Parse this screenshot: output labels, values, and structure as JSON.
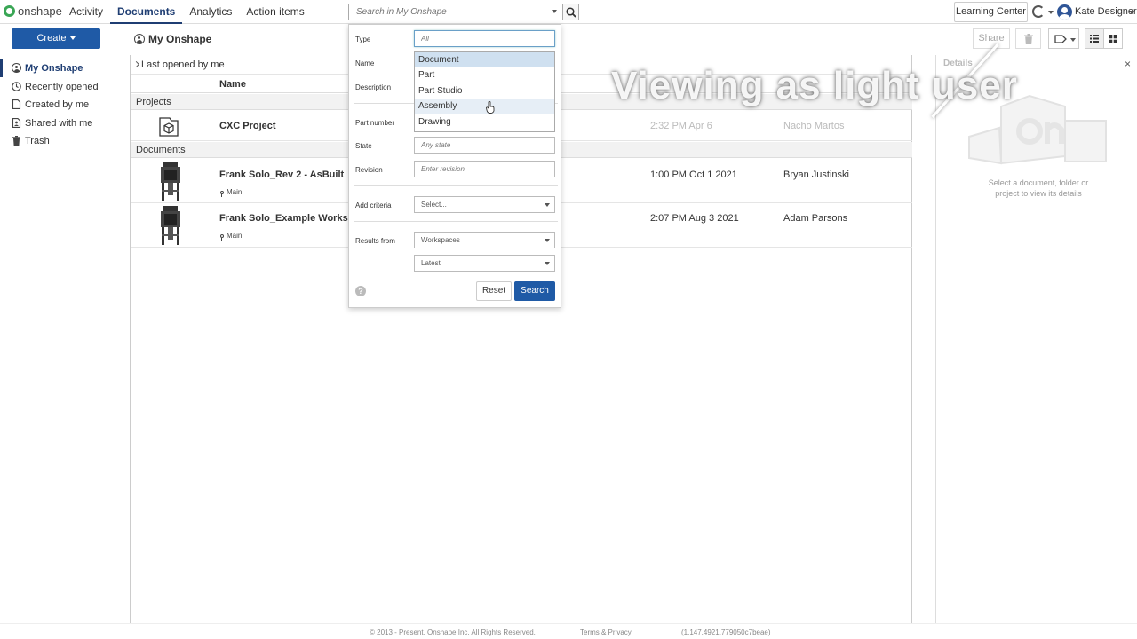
{
  "app": {
    "logo_text": "onshape"
  },
  "nav": [
    {
      "label": "Activity"
    },
    {
      "label": "Documents"
    },
    {
      "label": "Analytics"
    },
    {
      "label": "Action items"
    }
  ],
  "search": {
    "placeholder": "Search in My Onshape"
  },
  "header": {
    "learning_center": "Learning Center",
    "user_name": "Kate Designer"
  },
  "toolbar": {
    "create_label": "Create",
    "share_label": "Share"
  },
  "page_title": "My Onshape",
  "sidebar": {
    "items": [
      {
        "label": "My Onshape"
      },
      {
        "label": "Recently opened"
      },
      {
        "label": "Created by me"
      },
      {
        "label": "Shared with me"
      },
      {
        "label": "Trash"
      }
    ]
  },
  "list": {
    "filter_label": "Last opened by me",
    "column_name": "Name",
    "projects_label": "Projects",
    "documents_label": "Documents",
    "projects": [
      {
        "name": "CXC Project",
        "date": "2:32 PM Apr 6",
        "user": "Nacho Martos"
      }
    ],
    "documents": [
      {
        "name": "Frank Solo_Rev 2 - AsBuilt",
        "branch": "Main",
        "date": "1:00 PM Oct 1 2021",
        "user": "Bryan Justinski"
      },
      {
        "name": "Frank Solo_Example Workspace",
        "branch": "Main",
        "date": "2:07 PM Aug 3 2021",
        "user": "Adam Parsons"
      }
    ]
  },
  "details": {
    "title": "Details",
    "close": "×",
    "message": "Select a document, folder or project to view its details"
  },
  "advanced_search": {
    "type_label": "Type",
    "type_placeholder": "All",
    "name_label": "Name",
    "description_label": "Description",
    "part_number_label": "Part number",
    "state_label": "State",
    "state_placeholder": "Any state",
    "revision_label": "Revision",
    "revision_placeholder": "Enter revision",
    "add_criteria_label": "Add criteria",
    "add_criteria_value": "Select...",
    "results_from_label": "Results from",
    "results_from_value": "Workspaces",
    "version_value": "Latest",
    "help": "?",
    "reset_label": "Reset",
    "search_label": "Search",
    "type_options": [
      {
        "label": "Document"
      },
      {
        "label": "Part"
      },
      {
        "label": "Part Studio"
      },
      {
        "label": "Assembly"
      },
      {
        "label": "Drawing"
      }
    ]
  },
  "footer": {
    "copyright": "© 2013 - Present, Onshape Inc. All Rights Reserved.",
    "terms": "Terms & Privacy",
    "version": "(1.147.4921.779050c7beae)"
  },
  "watermark": "Viewing as light user",
  "colors": {
    "accent": "#1f5aa6",
    "nav_active": "#1f3e73",
    "logo": "#3aa655"
  }
}
